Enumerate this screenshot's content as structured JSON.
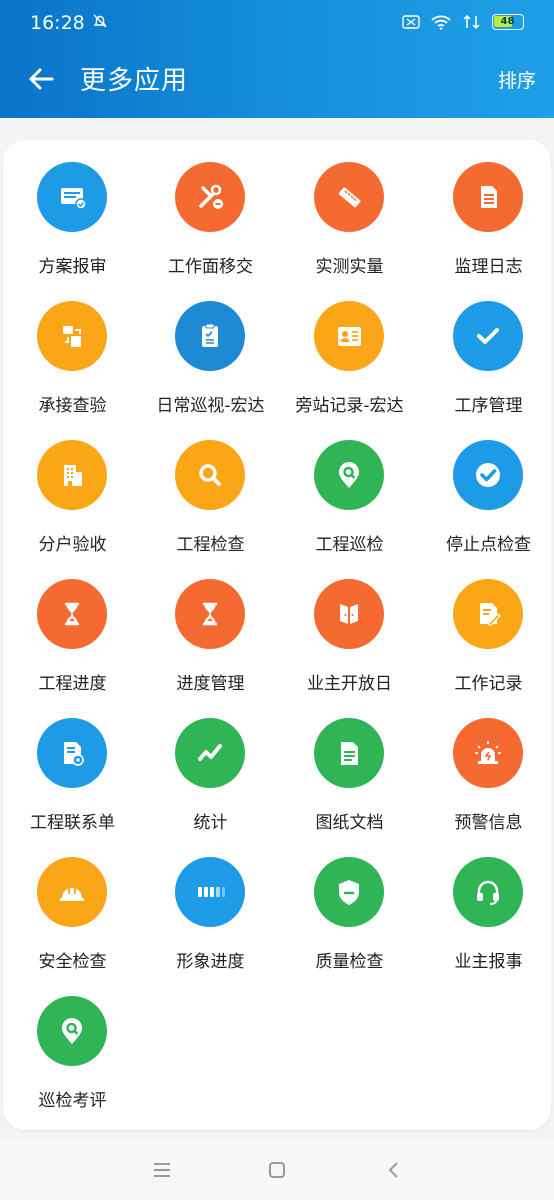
{
  "status": {
    "time": "16:28",
    "battery": "48"
  },
  "header": {
    "title": "更多应用",
    "sort_label": "排序"
  },
  "apps": [
    {
      "label": "方案报审",
      "icon": "document-check-icon",
      "color": "#1d9be6"
    },
    {
      "label": "工作面移交",
      "icon": "tools-icon",
      "color": "#f56a31"
    },
    {
      "label": "实测实量",
      "icon": "ruler-icon",
      "color": "#f56a31"
    },
    {
      "label": "监理日志",
      "icon": "log-icon",
      "color": "#f56a31"
    },
    {
      "label": "承接查验",
      "icon": "handover-icon",
      "color": "#fba617"
    },
    {
      "label": "日常巡视-宏达",
      "icon": "clipboard-icon",
      "color": "#1d8ad6"
    },
    {
      "label": "旁站记录-宏达",
      "icon": "id-card-icon",
      "color": "#fba617"
    },
    {
      "label": "工序管理",
      "icon": "checkmark-icon",
      "color": "#1d9be6"
    },
    {
      "label": "分户验收",
      "icon": "building-icon",
      "color": "#fba617"
    },
    {
      "label": "工程检查",
      "icon": "search-icon",
      "color": "#fba617"
    },
    {
      "label": "工程巡检",
      "icon": "location-search-icon",
      "color": "#2fb456"
    },
    {
      "label": "停止点检查",
      "icon": "check-circle-icon",
      "color": "#1d9be6"
    },
    {
      "label": "工程进度",
      "icon": "hourglass-icon",
      "color": "#f56a31"
    },
    {
      "label": "进度管理",
      "icon": "hourglass-icon",
      "color": "#f56a31"
    },
    {
      "label": "业主开放日",
      "icon": "door-icon",
      "color": "#f56a31"
    },
    {
      "label": "工作记录",
      "icon": "edit-note-icon",
      "color": "#fba617"
    },
    {
      "label": "工程联系单",
      "icon": "contact-doc-icon",
      "color": "#1d9be6"
    },
    {
      "label": "统计",
      "icon": "trend-icon",
      "color": "#2fb456"
    },
    {
      "label": "图纸文档",
      "icon": "file-icon",
      "color": "#2fb456"
    },
    {
      "label": "预警信息",
      "icon": "alarm-icon",
      "color": "#f56a31"
    },
    {
      "label": "安全检查",
      "icon": "helmet-icon",
      "color": "#fba617"
    },
    {
      "label": "形象进度",
      "icon": "progress-icon",
      "color": "#1d9be6"
    },
    {
      "label": "质量检查",
      "icon": "shield-icon",
      "color": "#2fb456"
    },
    {
      "label": "业主报事",
      "icon": "headset-icon",
      "color": "#2fb456"
    },
    {
      "label": "巡检考评",
      "icon": "location-search-icon",
      "color": "#2fb456"
    }
  ]
}
